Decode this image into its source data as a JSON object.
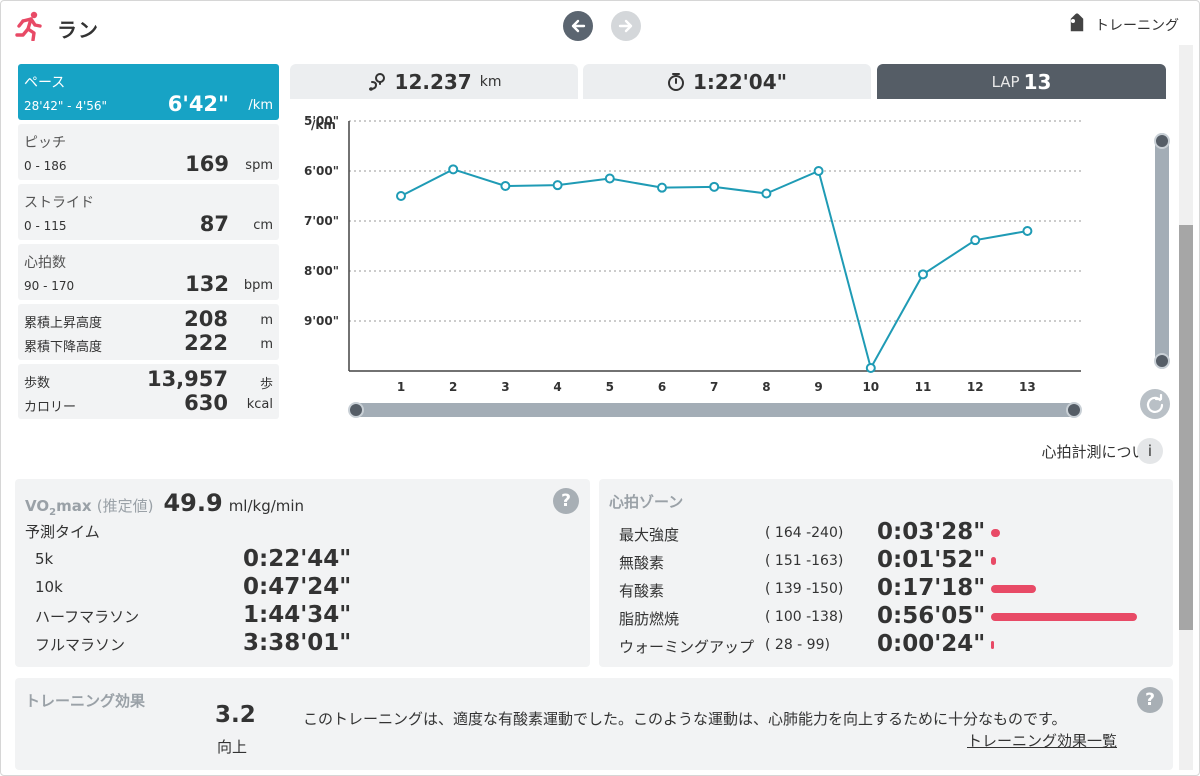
{
  "header": {
    "title": "ラン",
    "training_label": "トレーニング"
  },
  "stats": {
    "pace": {
      "label": "ペース",
      "range": "28'42\" - 4'56\"",
      "value": "6'42\"",
      "unit": "/km"
    },
    "pitch": {
      "label": "ピッチ",
      "range": "0 - 186",
      "value": "169",
      "unit": "spm"
    },
    "stride": {
      "label": "ストライド",
      "range": "0 - 115",
      "value": "87",
      "unit": "cm"
    },
    "heart_rate": {
      "label": "心拍数",
      "range": "90 - 170",
      "value": "132",
      "unit": "bpm"
    },
    "elevation": {
      "ascent_label": "累積上昇高度",
      "ascent_value": "208",
      "ascent_unit": "m",
      "descent_label": "累積下降高度",
      "descent_value": "222",
      "descent_unit": "m"
    },
    "steps": {
      "steps_label": "歩数",
      "steps_value": "13,957",
      "steps_unit": "歩",
      "cal_label": "カロリー",
      "cal_value": "630",
      "cal_unit": "kcal"
    }
  },
  "tabs": {
    "distance_value": "12.237",
    "distance_unit": "km",
    "time_value": "1:22'04\"",
    "lap_label": "LAP",
    "lap_value": "13"
  },
  "chart_data": {
    "type": "line",
    "ylabel": "/km",
    "y_inverted": true,
    "ylim_seconds": [
      300,
      600
    ],
    "ytick_labels": [
      "5'00\"",
      "6'00\"",
      "7'00\"",
      "8'00\"",
      "9'00\""
    ],
    "ytick_seconds": [
      300,
      360,
      420,
      480,
      540
    ],
    "categories": [
      "1",
      "2",
      "3",
      "4",
      "5",
      "6",
      "7",
      "8",
      "9",
      "10",
      "11",
      "12",
      "13"
    ],
    "values_seconds": [
      390,
      358,
      378,
      377,
      369,
      380,
      379,
      387,
      360,
      605,
      484,
      443,
      432
    ],
    "line_color": "#1f9bb5",
    "grid": "horizontal-dotted"
  },
  "hr_info": "心拍計測について",
  "vo2": {
    "label_vo": "VO",
    "label_sub": "2",
    "label_max": "max",
    "label_est": "(推定値)",
    "value": "49.9",
    "unit": "ml/kg/min",
    "pred_title": "予測タイム",
    "predictions": [
      {
        "name": "5k",
        "time": "0:22'44\""
      },
      {
        "name": "10k",
        "time": "0:47'24\""
      },
      {
        "name": "ハーフマラソン",
        "time": "1:44'34\""
      },
      {
        "name": "フルマラソン",
        "time": "3:38'01\""
      }
    ]
  },
  "zones": {
    "title": "心拍ゾーン",
    "bar_color": "#e84a66",
    "rows": [
      {
        "name": "最大強度",
        "range": "( 164 -240)",
        "time": "0:03'28\"",
        "fraction": 0.06
      },
      {
        "name": "無酸素",
        "range": "( 151 -163)",
        "time": "0:01'52\"",
        "fraction": 0.033
      },
      {
        "name": "有酸素",
        "range": "( 139 -150)",
        "time": "0:17'18\"",
        "fraction": 0.31
      },
      {
        "name": "脂肪燃焼",
        "range": "( 100 -138)",
        "time": "0:56'05\"",
        "fraction": 1.0
      },
      {
        "name": "ウォーミングアップ",
        "range": "(  28 -  99)",
        "time": "0:00'24\"",
        "fraction": 0.007
      }
    ]
  },
  "training_effect": {
    "title": "トレーニング効果",
    "value": "3.2",
    "sub": "向上",
    "description": "このトレーニングは、適度な有酸素運動でした。このような運動は、心肺能力を向上するために十分なものです。",
    "link": "トレーニング効果一覧"
  },
  "help_label": "?"
}
